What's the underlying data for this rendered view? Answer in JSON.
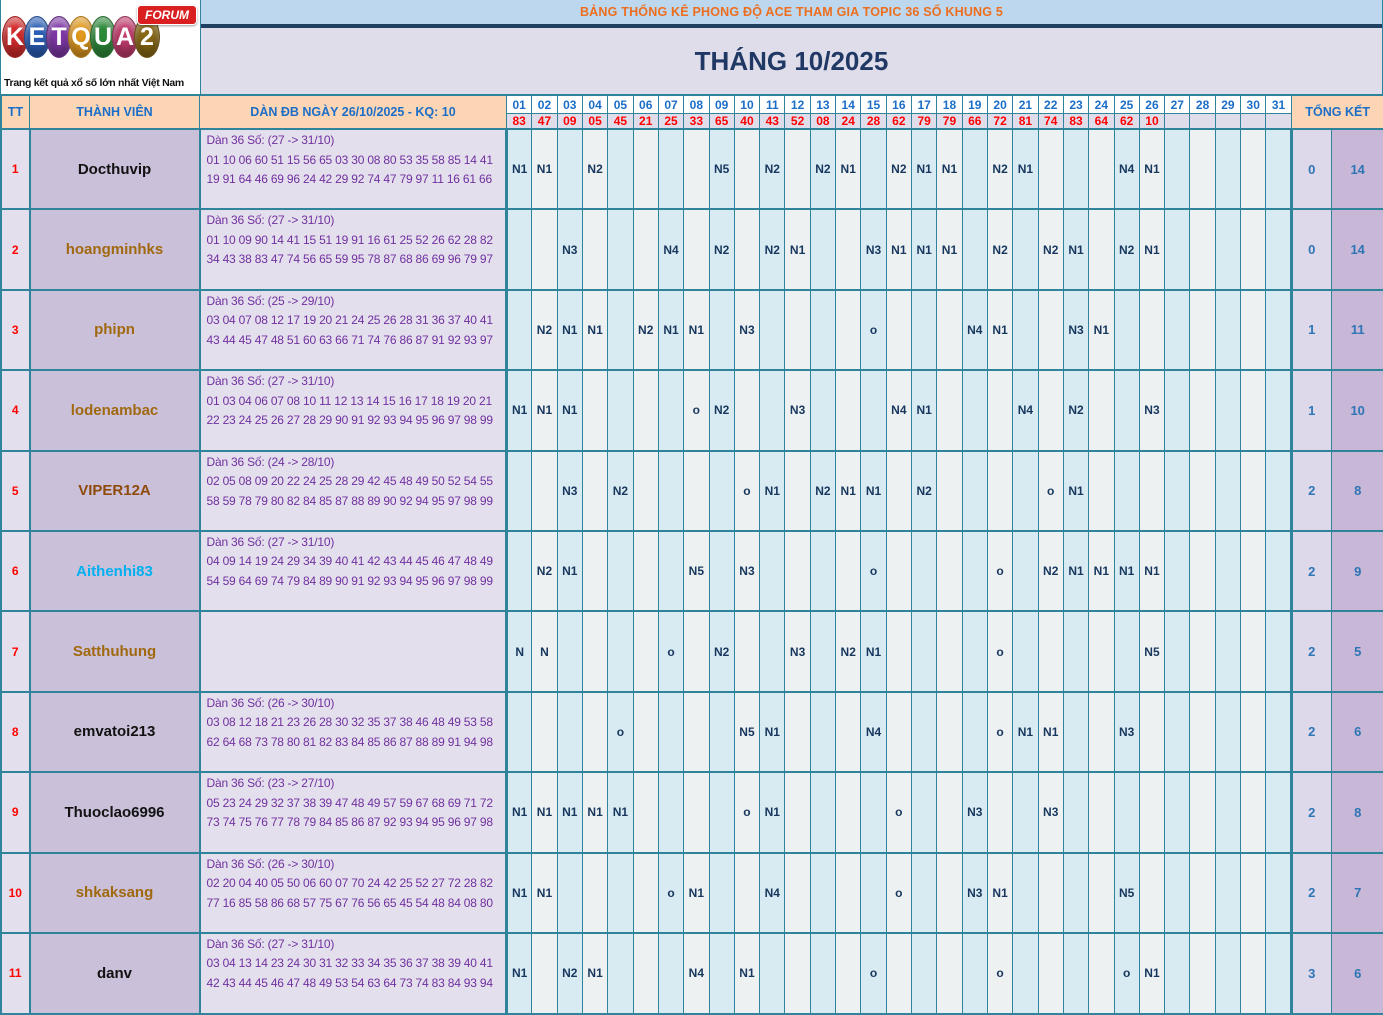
{
  "logo": {
    "letters": [
      {
        "ch": "K",
        "color": "#D42B2B"
      },
      {
        "ch": "E",
        "color": "#2B5FB8"
      },
      {
        "ch": "T",
        "color": "#8038A8"
      },
      {
        "ch": "Q",
        "color": "#E39A1E"
      },
      {
        "ch": "U",
        "color": "#2E8B3A"
      },
      {
        "ch": "A",
        "color": "#C23B6E"
      },
      {
        "ch": "2",
        "color": "#8B6914"
      }
    ],
    "forum_badge": "FORUM",
    "tagline": "Trang kết quả xổ số lớn nhất Việt Nam"
  },
  "banner": {
    "title": "BẢNG THỐNG KÊ PHONG ĐỘ ACE THAM GIA TOPIC 36 SỐ KHUNG 5",
    "month": "THÁNG 10/2025"
  },
  "columns": {
    "tt": "TT",
    "member": "THÀNH VIÊN",
    "dan": "DÀN ĐB NGÀY 26/10/2025 - KQ: 10",
    "total": "TỔNG KẾT"
  },
  "days": [
    {
      "num": "01",
      "val": "83"
    },
    {
      "num": "02",
      "val": "47"
    },
    {
      "num": "03",
      "val": "09"
    },
    {
      "num": "04",
      "val": "05"
    },
    {
      "num": "05",
      "val": "45"
    },
    {
      "num": "06",
      "val": "21"
    },
    {
      "num": "07",
      "val": "25"
    },
    {
      "num": "08",
      "val": "33"
    },
    {
      "num": "09",
      "val": "65"
    },
    {
      "num": "10",
      "val": "40"
    },
    {
      "num": "11",
      "val": "43"
    },
    {
      "num": "12",
      "val": "52"
    },
    {
      "num": "13",
      "val": "08"
    },
    {
      "num": "14",
      "val": "24"
    },
    {
      "num": "15",
      "val": "28"
    },
    {
      "num": "16",
      "val": "62"
    },
    {
      "num": "17",
      "val": "79"
    },
    {
      "num": "18",
      "val": "79"
    },
    {
      "num": "19",
      "val": "66"
    },
    {
      "num": "20",
      "val": "72"
    },
    {
      "num": "21",
      "val": "81"
    },
    {
      "num": "22",
      "val": "74"
    },
    {
      "num": "23",
      "val": "83"
    },
    {
      "num": "24",
      "val": "64"
    },
    {
      "num": "25",
      "val": "62"
    },
    {
      "num": "26",
      "val": "10"
    },
    {
      "num": "27",
      "val": ""
    },
    {
      "num": "28",
      "val": ""
    },
    {
      "num": "29",
      "val": ""
    },
    {
      "num": "30",
      "val": ""
    },
    {
      "num": "31",
      "val": ""
    }
  ],
  "rows": [
    {
      "tt": "1",
      "name": "Docthuvip",
      "name_color": "#111111",
      "dan_title": "Dàn 36 Số: (27 -> 31/10)",
      "dan_numbers": "01 10 06 60 51 15 56 65 03 30 08 80 53 35 58 85 14 41 19 91 64 46 69 96 24 42 29 92 74 47 79 97 11 16 61 66",
      "cells": {
        "01": "N1",
        "02": "N1",
        "04": "N2",
        "09": "N5",
        "11": "N2",
        "13": "N2",
        "14": "N1",
        "16": "N2",
        "17": "N1",
        "18": "N1",
        "20": "N2",
        "21": "N1",
        "25": "N4",
        "26": "N1"
      },
      "miss": "0",
      "hit": "14"
    },
    {
      "tt": "2",
      "name": "hoangminhks",
      "name_color": "#A0690F",
      "dan_title": "Dàn 36 Số: (27 -> 31/10)",
      "dan_numbers": "01 10 09 90 14 41 15 51 19 91 16 61 25 52 26 62 28 82 34 43 38 83 47 74 56 65 59 95 78 87 68 86 69 96 79 97",
      "cells": {
        "03": "N3",
        "07": "N4",
        "09": "N2",
        "11": "N2",
        "12": "N1",
        "15": "N3",
        "16": "N1",
        "17": "N1",
        "18": "N1",
        "20": "N2",
        "22": "N2",
        "23": "N1",
        "25": "N2",
        "26": "N1"
      },
      "miss": "0",
      "hit": "14"
    },
    {
      "tt": "3",
      "name": "phipn",
      "name_color": "#A0690F",
      "dan_title": "Dàn 36 Số: (25 -> 29/10)",
      "dan_numbers": "03 04 07 08 12 17 19 20 21 24 25 26 28 31 36 37 40 41 43 44 45 47 48 51 60 63 66 71 74 76 86 87 91 92 93 97",
      "cells": {
        "02": "N2",
        "03": "N1",
        "04": "N1",
        "06": "N2",
        "07": "N1",
        "08": "N1",
        "10": "N3",
        "15": "o",
        "19": "N4",
        "20": "N1",
        "23": "N3",
        "24": "N1"
      },
      "miss": "1",
      "hit": "11"
    },
    {
      "tt": "4",
      "name": "lodenambac",
      "name_color": "#A0690F",
      "dan_title": "Dàn 36 Số: (27 -> 31/10)",
      "dan_numbers": "01 03 04 06 07 08 10 11 12 13 14 15 16 17 18 19 20 21 22 23 24 25 26 27 28 29 90 91 92 93 94 95 96 97 98 99",
      "cells": {
        "01": "N1",
        "02": "N1",
        "03": "N1",
        "08": "o",
        "09": "N2",
        "12": "N3",
        "16": "N4",
        "17": "N1",
        "21": "N4",
        "23": "N2",
        "26": "N3"
      },
      "miss": "1",
      "hit": "10"
    },
    {
      "tt": "5",
      "name": "VIPER12A",
      "name_color": "#8E4B0B",
      "dan_title": "Dàn 36 Số: (24 -> 28/10)",
      "dan_numbers": "02 05 08 09 20 22 24 25 28 29 42 45 48 49 50 52 54 55 58 59 78 79 80 82 84 85 87 88 89 90 92 94 95 97 98 99",
      "cells": {
        "03": "N3",
        "05": "N2",
        "10": "o",
        "11": "N1",
        "13": "N2",
        "14": "N1",
        "15": "N1",
        "17": "N2",
        "22": "o",
        "23": "N1"
      },
      "miss": "2",
      "hit": "8"
    },
    {
      "tt": "6",
      "name": "Aithenhi83",
      "name_color": "#00B0F0",
      "dan_title": "Dàn 36 Số: (27 -> 31/10)",
      "dan_numbers": "04 09 14 19 24 29 34 39 40 41 42 43 44 45 46 47 48 49 54 59 64 69 74 79 84 89 90 91 92 93 94 95 96 97 98 99",
      "cells": {
        "02": "N2",
        "03": "N1",
        "08": "N5",
        "10": "N3",
        "15": "o",
        "20": "o",
        "22": "N2",
        "23": "N1",
        "24": "N1",
        "25": "N1",
        "26": "N1"
      },
      "miss": "2",
      "hit": "9"
    },
    {
      "tt": "7",
      "name": "Satthuhung",
      "name_color": "#A0690F",
      "dan_title": "",
      "dan_numbers": "",
      "cells": {
        "01": "N",
        "02": "N",
        "07": "o",
        "09": "N2",
        "12": "N3",
        "14": "N2",
        "15": "N1",
        "20": "o",
        "26": "N5"
      },
      "miss": "2",
      "hit": "5"
    },
    {
      "tt": "8",
      "name": "emvatoi213",
      "name_color": "#111111",
      "dan_title": "Dàn 36 Số: (26 -> 30/10)",
      "dan_numbers": "03 08 12 18 21 23 26 28 30 32 35 37 38 46 48 49 53 58 62 64 68 73 78 80 81 82 83 84 85 86 87 88 89 91 94 98",
      "cells": {
        "05": "o",
        "10": "N5",
        "11": "N1",
        "15": "N4",
        "20": "o",
        "21": "N1",
        "22": "N1",
        "25": "N3"
      },
      "miss": "2",
      "hit": "6"
    },
    {
      "tt": "9",
      "name": "Thuoclao6996",
      "name_color": "#111111",
      "dan_title": "Dàn 36 Số: (23 -> 27/10)",
      "dan_numbers": "05 23 24 29 32 37 38 39 47 48 49 57 59 67 68 69 71 72 73 74 75 76 77 78 79 84 85 86 87 92 93 94 95 96 97 98",
      "cells": {
        "01": "N1",
        "02": "N1",
        "03": "N1",
        "04": "N1",
        "05": "N1",
        "10": "o",
        "11": "N1",
        "16": "o",
        "19": "N3",
        "22": "N3"
      },
      "miss": "2",
      "hit": "8"
    },
    {
      "tt": "10",
      "name": "shkaksang",
      "name_color": "#A0690F",
      "dan_title": "Dàn 36 Số: (26 -> 30/10)",
      "dan_numbers": "02 20 04 40 05 50 06 60 07 70 24 42 25 52 27 72 28 82 77 16 85 58 86 68 57 75 67 76 56 65 45 54 48 84 08 80",
      "cells": {
        "01": "N1",
        "02": "N1",
        "07": "o",
        "08": "N1",
        "11": "N4",
        "16": "o",
        "19": "N3",
        "20": "N1",
        "25": "N5"
      },
      "miss": "2",
      "hit": "7"
    },
    {
      "tt": "11",
      "name": "danv",
      "name_color": "#111111",
      "dan_title": "Dàn 36 Số: (27 -> 31/10)",
      "dan_numbers": "03 04 13 14 23 24 30 31 32 33 34 35 36 37 38 39 40 41 42 43 44 45 46 47 48 49 53 54 63 64 73 74 83 84 93 94",
      "cells": {
        "01": "N1",
        "03": "N2",
        "04": "N1",
        "08": "N4",
        "10": "N1",
        "15": "o",
        "20": "o",
        "25": "o",
        "26": "N1"
      },
      "miss": "3",
      "hit": "6"
    }
  ]
}
